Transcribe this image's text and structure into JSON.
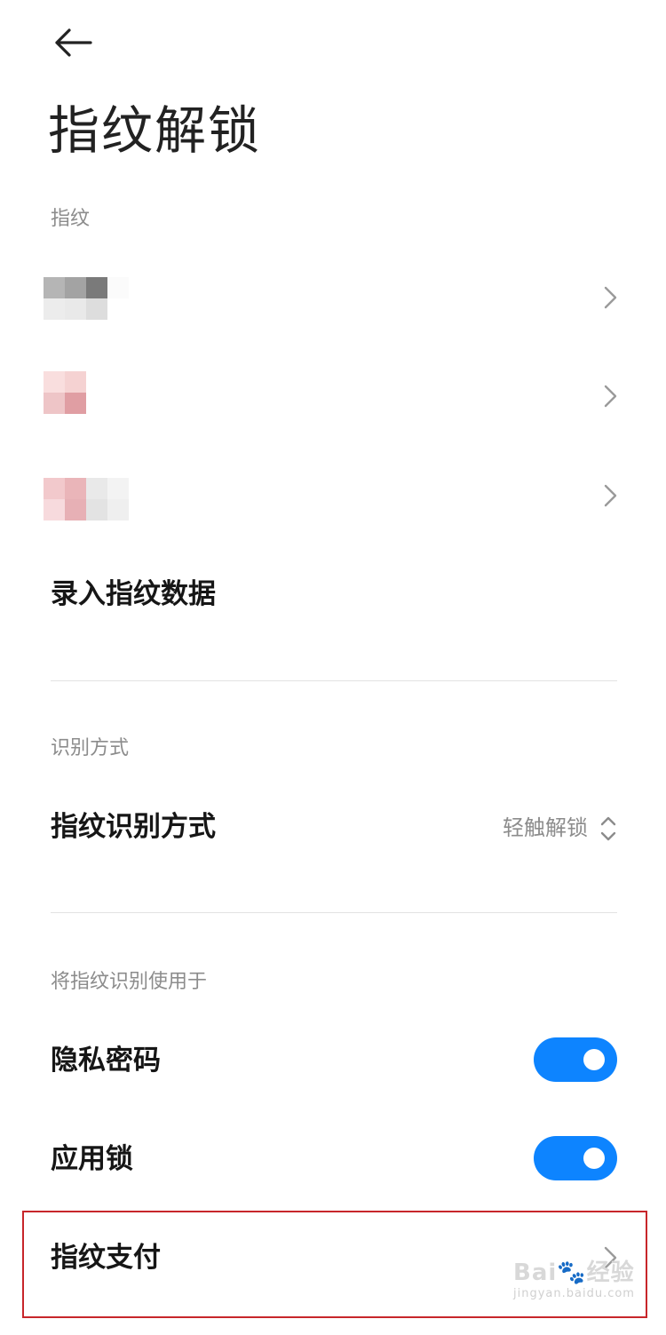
{
  "header": {
    "back_icon": "arrow-left-icon",
    "title": "指纹解锁"
  },
  "fingerprints": {
    "section_label": "指纹",
    "items": [
      {
        "name_pixels": [
          "#b5b5b5",
          "#a3a3a3",
          "#7a7a7a",
          "#fbfbfb",
          "#ececec",
          "#e9e9e9",
          "#dddddd",
          "#ffffff"
        ]
      },
      {
        "name_pixels": [
          "#f9dede",
          "#f5d2d2",
          "#ffffff",
          "#ffffff",
          "#eec5c7",
          "#e09ea3",
          "#ffffff",
          "#ffffff"
        ]
      },
      {
        "name_pixels": [
          "#f2c9cc",
          "#eab5b9",
          "#e9e9e9",
          "#f3f3f3",
          "#f7dadd",
          "#e7b0b5",
          "#e3e3e3",
          "#efefef"
        ]
      }
    ],
    "add_label": "录入指纹数据",
    "chevron_icon": "chevron-right-icon"
  },
  "recognition": {
    "section_label": "识别方式",
    "row_label": "指纹识别方式",
    "value": "轻触解锁",
    "icon": "chevron-up-down-icon"
  },
  "usage": {
    "section_label": "将指纹识别使用于",
    "items": [
      {
        "label": "隐私密码",
        "enabled": true
      },
      {
        "label": "应用锁",
        "enabled": true
      }
    ],
    "payment_label": "指纹支付"
  },
  "colors": {
    "accent": "#0d84ff",
    "highlight_border": "#c7262b"
  },
  "watermark": {
    "main": "Bai🐾经验",
    "sub": "jingyan.baidu.com"
  }
}
